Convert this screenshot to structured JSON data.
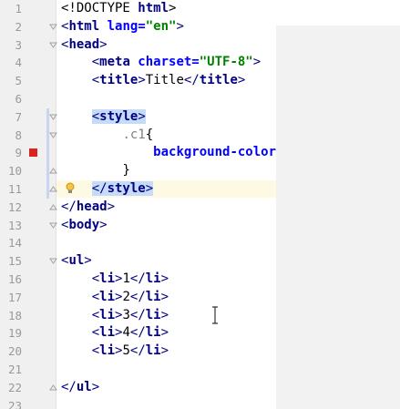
{
  "editor": {
    "lines": [
      {
        "num": "1",
        "indent": 0,
        "tokens": [
          {
            "t": "<!DOCTYPE ",
            "c": "tok-text"
          },
          {
            "t": "html",
            "c": "tok-tag"
          },
          {
            "t": ">",
            "c": "tok-text"
          }
        ]
      },
      {
        "num": "2",
        "indent": 0,
        "fold": "open",
        "tokens": [
          {
            "t": "<",
            "c": "tok-punct"
          },
          {
            "t": "html",
            "c": "tok-tag"
          },
          {
            "t": " lang=",
            "c": "tok-attr"
          },
          {
            "t": "\"en\"",
            "c": "tok-str"
          },
          {
            "t": ">",
            "c": "tok-punct"
          }
        ]
      },
      {
        "num": "3",
        "indent": 0,
        "fold": "open",
        "tokens": [
          {
            "t": "<",
            "c": "tok-punct"
          },
          {
            "t": "head",
            "c": "tok-tag"
          },
          {
            "t": ">",
            "c": "tok-punct"
          }
        ]
      },
      {
        "num": "4",
        "indent": 4,
        "tokens": [
          {
            "t": "<",
            "c": "tok-punct"
          },
          {
            "t": "meta",
            "c": "tok-tag"
          },
          {
            "t": " charset=",
            "c": "tok-attr"
          },
          {
            "t": "\"UTF-8\"",
            "c": "tok-str"
          },
          {
            "t": ">",
            "c": "tok-punct"
          }
        ]
      },
      {
        "num": "5",
        "indent": 4,
        "tokens": [
          {
            "t": "<",
            "c": "tok-punct"
          },
          {
            "t": "title",
            "c": "tok-tag"
          },
          {
            "t": ">",
            "c": "tok-punct"
          },
          {
            "t": "Title",
            "c": "tok-text"
          },
          {
            "t": "</",
            "c": "tok-punct"
          },
          {
            "t": "title",
            "c": "tok-tag"
          },
          {
            "t": ">",
            "c": "tok-punct"
          }
        ]
      },
      {
        "num": "6",
        "indent": 0,
        "tokens": []
      },
      {
        "num": "7",
        "indent": 4,
        "fold": "open",
        "tokens": [
          {
            "t": "<",
            "c": "tok-punct sel"
          },
          {
            "t": "style",
            "c": "tok-tag sel"
          },
          {
            "t": ">",
            "c": "tok-punct sel"
          }
        ]
      },
      {
        "num": "8",
        "indent": 8,
        "fold": "open",
        "tokens": [
          {
            "t": ".c1",
            "c": "tok-selector"
          },
          {
            "t": "{",
            "c": "tok-text"
          }
        ]
      },
      {
        "num": "9",
        "indent": 12,
        "breakpoint": true,
        "tokens": [
          {
            "t": "background-color",
            "c": "tok-prop"
          }
        ]
      },
      {
        "num": "10",
        "indent": 8,
        "fold": "close",
        "tokens": [
          {
            "t": "}",
            "c": "tok-text"
          }
        ]
      },
      {
        "num": "11",
        "indent": 4,
        "fold": "close",
        "caret": true,
        "bulb": true,
        "tokens": [
          {
            "t": "</",
            "c": "tok-punct sel"
          },
          {
            "t": "style",
            "c": "tok-tag sel"
          },
          {
            "t": ">",
            "c": "tok-punct sel"
          }
        ]
      },
      {
        "num": "12",
        "indent": 0,
        "fold": "close",
        "tokens": [
          {
            "t": "</",
            "c": "tok-punct"
          },
          {
            "t": "head",
            "c": "tok-tag"
          },
          {
            "t": ">",
            "c": "tok-punct"
          }
        ]
      },
      {
        "num": "13",
        "indent": 0,
        "fold": "open",
        "tokens": [
          {
            "t": "<",
            "c": "tok-punct"
          },
          {
            "t": "body",
            "c": "tok-tag"
          },
          {
            "t": ">",
            "c": "tok-punct"
          }
        ]
      },
      {
        "num": "14",
        "indent": 0,
        "tokens": []
      },
      {
        "num": "15",
        "indent": 0,
        "fold": "open",
        "tokens": [
          {
            "t": "<",
            "c": "tok-punct"
          },
          {
            "t": "ul",
            "c": "tok-tag"
          },
          {
            "t": ">",
            "c": "tok-punct"
          }
        ]
      },
      {
        "num": "16",
        "indent": 4,
        "tokens": [
          {
            "t": "<",
            "c": "tok-punct"
          },
          {
            "t": "li",
            "c": "tok-tag"
          },
          {
            "t": ">",
            "c": "tok-punct"
          },
          {
            "t": "1",
            "c": "tok-text"
          },
          {
            "t": "</",
            "c": "tok-punct"
          },
          {
            "t": "li",
            "c": "tok-tag"
          },
          {
            "t": ">",
            "c": "tok-punct"
          }
        ]
      },
      {
        "num": "17",
        "indent": 4,
        "tokens": [
          {
            "t": "<",
            "c": "tok-punct"
          },
          {
            "t": "li",
            "c": "tok-tag"
          },
          {
            "t": ">",
            "c": "tok-punct"
          },
          {
            "t": "2",
            "c": "tok-text"
          },
          {
            "t": "</",
            "c": "tok-punct"
          },
          {
            "t": "li",
            "c": "tok-tag"
          },
          {
            "t": ">",
            "c": "tok-punct"
          }
        ]
      },
      {
        "num": "18",
        "indent": 4,
        "tokens": [
          {
            "t": "<",
            "c": "tok-punct"
          },
          {
            "t": "li",
            "c": "tok-tag"
          },
          {
            "t": ">",
            "c": "tok-punct"
          },
          {
            "t": "3",
            "c": "tok-text"
          },
          {
            "t": "</",
            "c": "tok-punct"
          },
          {
            "t": "li",
            "c": "tok-tag"
          },
          {
            "t": ">",
            "c": "tok-punct"
          }
        ]
      },
      {
        "num": "19",
        "indent": 4,
        "tokens": [
          {
            "t": "<",
            "c": "tok-punct"
          },
          {
            "t": "li",
            "c": "tok-tag"
          },
          {
            "t": ">",
            "c": "tok-punct"
          },
          {
            "t": "4",
            "c": "tok-text"
          },
          {
            "t": "</",
            "c": "tok-punct"
          },
          {
            "t": "li",
            "c": "tok-tag"
          },
          {
            "t": ">",
            "c": "tok-punct"
          }
        ]
      },
      {
        "num": "20",
        "indent": 4,
        "tokens": [
          {
            "t": "<",
            "c": "tok-punct"
          },
          {
            "t": "li",
            "c": "tok-tag"
          },
          {
            "t": ">",
            "c": "tok-punct"
          },
          {
            "t": "5",
            "c": "tok-text"
          },
          {
            "t": "</",
            "c": "tok-punct"
          },
          {
            "t": "li",
            "c": "tok-tag"
          },
          {
            "t": ">",
            "c": "tok-punct"
          }
        ]
      },
      {
        "num": "21",
        "indent": 0,
        "tokens": []
      },
      {
        "num": "22",
        "indent": 0,
        "fold": "close",
        "tokens": [
          {
            "t": "</",
            "c": "tok-punct"
          },
          {
            "t": "ul",
            "c": "tok-tag"
          },
          {
            "t": ">",
            "c": "tok-punct"
          }
        ]
      },
      {
        "num": "23",
        "indent": 0,
        "tokens": []
      }
    ],
    "icons": {
      "breakpoint": "breakpoint-icon",
      "intention": "lightbulb-icon",
      "fold": "fold-marker-icon",
      "cursor": "text-cursor-icon"
    },
    "colors": {
      "tag": "#000080",
      "attribute": "#0000ff",
      "string": "#008000",
      "selection": "#c6dbfa",
      "caret_row": "#fdf9e3",
      "breakpoint": "#d9231d"
    }
  }
}
